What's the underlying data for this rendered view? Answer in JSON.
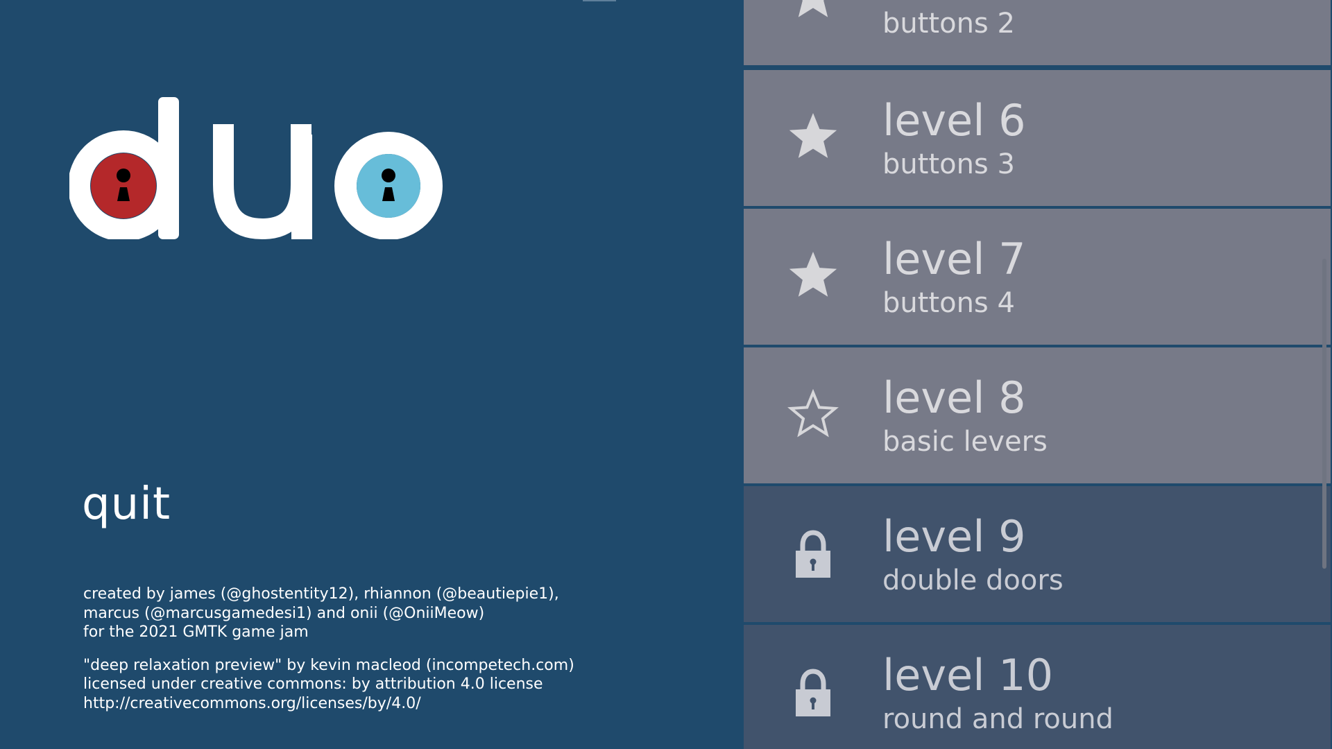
{
  "game": {
    "logo_text": "duo"
  },
  "menu": {
    "quit_label": "quit"
  },
  "credits": {
    "lines": [
      "created by james (@ghostentity12), rhiannon (@beautiepie1),",
      "marcus (@marcusgamedesi1) and onii (@OniiMeow)",
      "for the 2021 GMTK game jam",
      "\"deep relaxation preview\" by kevin macleod (incompetech.com)",
      "licensed under creative commons: by attribution 4.0 license",
      "http://creativecommons.org/licenses/by/4.0/"
    ]
  },
  "levels": [
    {
      "title": "",
      "subtitle": "buttons 2",
      "status": "completed",
      "icon": "star-filled-icon"
    },
    {
      "title": "level 6",
      "subtitle": "buttons 3",
      "status": "completed",
      "icon": "star-filled-icon"
    },
    {
      "title": "level 7",
      "subtitle": "buttons 4",
      "status": "completed",
      "icon": "star-filled-icon"
    },
    {
      "title": "level 8",
      "subtitle": "basic levers",
      "status": "unlocked",
      "icon": "star-outline-icon"
    },
    {
      "title": "level 9",
      "subtitle": "double doors",
      "status": "locked",
      "icon": "lock-icon"
    },
    {
      "title": "level 10",
      "subtitle": "round and round",
      "status": "locked",
      "icon": "lock-icon"
    }
  ],
  "colors": {
    "background": "#1f4a6c",
    "level_unlocked": "#777a88",
    "level_locked": "#41536c",
    "level_text": "#d9d9dd",
    "player_red": "#b4282a",
    "player_blue": "#67bdd9"
  }
}
